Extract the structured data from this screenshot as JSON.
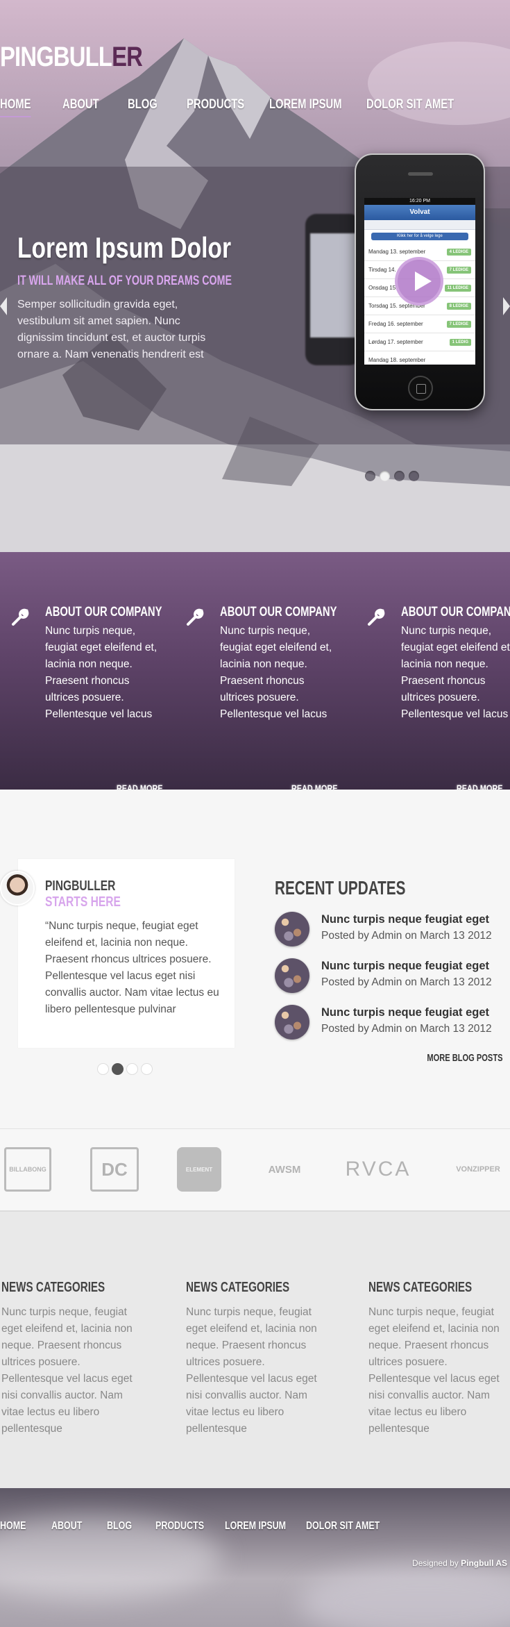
{
  "brand": {
    "logo_main": "PINGBULL",
    "logo_accent": "ER"
  },
  "nav": {
    "items": [
      "HOME",
      "ABOUT",
      "BLOG",
      "PRODUCTS",
      "LOREM IPSUM",
      "DOLOR SIT AMET"
    ],
    "active": "HOME"
  },
  "hero": {
    "title": "Lorem Ipsum Dolor",
    "subtitle": "IT WILL MAKE ALL OF YOUR DREAMS COME",
    "text": "Semper sollicitudin gravida eget, vestibulum sit amet sapien. Nunc dignissim tincidunt est, et auctor turpis ornare a. Nam venenatis hendrerit est",
    "slide_count": 4,
    "active_slide": 2,
    "phone": {
      "time": "16:20 PM",
      "app_name": "Volvat",
      "pick_label": "Klikk her for å velge lege",
      "rows": [
        {
          "day": "Mandag 13. september",
          "badge": "4 LEDIGE"
        },
        {
          "day": "Tirsdag 14.",
          "badge": "7 LEDIGE"
        },
        {
          "day": "Onsdag 15.",
          "badge": "11 LEDIGE"
        },
        {
          "day": "Torsdag 15. september",
          "badge": "8 LEDIGE"
        },
        {
          "day": "Fredag 16. september",
          "badge": "7 LEDIGE"
        },
        {
          "day": "Lørdag 17. september",
          "badge": "1 LEDIG"
        },
        {
          "day": "Mandag 18. september",
          "badge": ""
        }
      ]
    }
  },
  "features": [
    {
      "title": "ABOUT OUR COMPANY",
      "text": "Nunc turpis neque, feugiat eget eleifend et, lacinia non neque. Praesent rhoncus ultrices posuere. Pellentesque vel lacus",
      "more": "READ MORE"
    },
    {
      "title": "ABOUT OUR COMPANY",
      "text": "Nunc turpis neque, feugiat eget eleifend et, lacinia non neque. Praesent rhoncus ultrices posuere. Pellentesque vel lacus",
      "more": "READ MORE"
    },
    {
      "title": "ABOUT OUR COMPANY",
      "text": "Nunc turpis neque, feugiat eget eleifend et, lacinia non neque. Praesent rhoncus ultrices posuere. Pellentesque vel lacus",
      "more": "READ MORE"
    }
  ],
  "testimonial": {
    "name": "PINGBULLER",
    "subtitle": "STARTS HERE",
    "quote": "“Nunc turpis neque, feugiat eget eleifend et, lacinia non neque. Praesent rhoncus ultrices posuere. Pellentesque vel lacus eget nisi convallis auctor. Nam vitae lectus eu libero pellentesque pulvinar",
    "dot_count": 4,
    "active_dot": 2
  },
  "updates": {
    "title": "RECENT UPDATES",
    "items": [
      {
        "title": "Nunc turpis neque feugiat eget",
        "meta": "Posted by Admin on March 13 2012"
      },
      {
        "title": "Nunc turpis neque feugiat eget",
        "meta": "Posted by Admin on March 13 2012"
      },
      {
        "title": "Nunc turpis neque feugiat eget",
        "meta": "Posted by Admin on March 13 2012"
      }
    ],
    "more": "MORE BLOG POSTS"
  },
  "brands": [
    "BILLABONG",
    "DC",
    "ELEMENT",
    "AWSM",
    "RVCA",
    "VONZIPPER"
  ],
  "news": [
    {
      "title": "NEWS CATEGORIES",
      "text": "Nunc turpis neque, feugiat eget eleifend et, lacinia non neque. Praesent rhoncus ultrices posuere. Pellentesque vel lacus eget nisi convallis auctor. Nam vitae lectus eu libero pellentesque"
    },
    {
      "title": "NEWS CATEGORIES",
      "text": "Nunc turpis neque, feugiat eget eleifend et, lacinia non neque. Praesent rhoncus ultrices posuere. Pellentesque vel lacus eget nisi convallis auctor. Nam vitae lectus eu libero pellentesque"
    },
    {
      "title": "NEWS CATEGORIES",
      "text": "Nunc turpis neque, feugiat eget eleifend et, lacinia non neque. Praesent rhoncus ultrices posuere. Pellentesque vel lacus eget nisi convallis auctor. Nam vitae lectus eu libero pellentesque"
    }
  ],
  "footer": {
    "nav": [
      "HOME",
      "ABOUT",
      "BLOG",
      "PRODUCTS",
      "LOREM IPSUM",
      "DOLOR SIT AMET"
    ],
    "credit_prefix": "Designed by",
    "credit_name": "Pingbull AS"
  },
  "colors": {
    "accent": "#d7a5ec",
    "purple": "#5e4368",
    "logo_dark": "#5b2a55"
  }
}
